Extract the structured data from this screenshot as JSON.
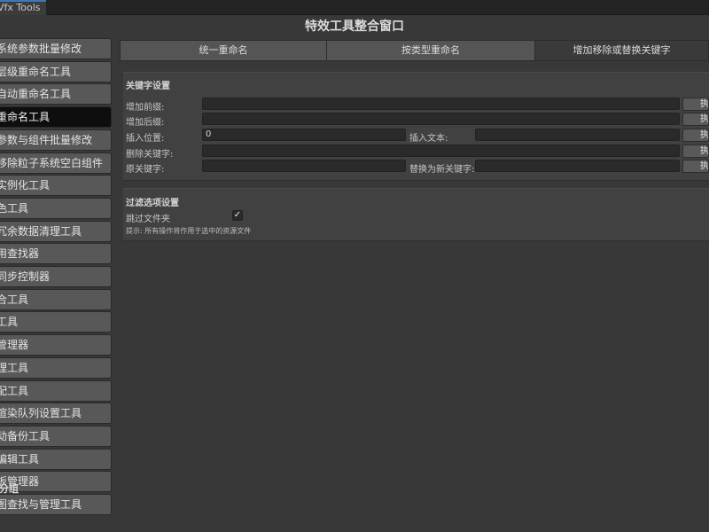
{
  "window": {
    "tab_label": "Vfx Tools",
    "title": "特效工具整合窗口"
  },
  "sidebar": {
    "items": [
      {
        "label": "系统参数批量修改"
      },
      {
        "label": "层级重命名工具"
      },
      {
        "label": "自动重命名工具"
      },
      {
        "label": "重命名工具",
        "active": true
      },
      {
        "label": "参数与组件批量修改"
      },
      {
        "label": "移除粒子系统空白组件"
      },
      {
        "label": "实例化工具"
      },
      {
        "label": "色工具"
      },
      {
        "label": "冗余数据清理工具"
      },
      {
        "label": "用查找器"
      },
      {
        "label": "同步控制器"
      },
      {
        "label": "合工具"
      },
      {
        "label": "工具"
      },
      {
        "label": "管理器"
      },
      {
        "label": "理工具"
      },
      {
        "label": "配工具"
      },
      {
        "label": "渲染队列设置工具"
      },
      {
        "label": "动备份工具"
      },
      {
        "label": "编辑工具"
      },
      {
        "label": "板管理器"
      },
      {
        "label": "图查找与管理工具"
      }
    ],
    "group_label": "分组"
  },
  "tabs": [
    {
      "label": "统一重命名"
    },
    {
      "label": "按类型重命名"
    },
    {
      "label": "增加移除或替换关键字",
      "active": true
    }
  ],
  "keyword": {
    "section_title": "关键字设置",
    "add_prefix_label": "增加前缀:",
    "add_prefix_value": "",
    "add_suffix_label": "增加后缀:",
    "add_suffix_value": "",
    "insert_pos_label": "插入位置:",
    "insert_pos_value": "0",
    "insert_text_label": "插入文本:",
    "insert_text_value": "",
    "remove_kw_label": "删除关键字:",
    "remove_kw_value": "",
    "orig_kw_label": "原关键字:",
    "orig_kw_value": "",
    "new_kw_label": "替换为新关键字:",
    "new_kw_value": "",
    "exec_label": "执行"
  },
  "filter": {
    "section_title": "过滤选项设置",
    "skip_folder_label": "跳过文件夹",
    "skip_folder_checked": true,
    "check_glyph": "✓",
    "hint": "提示: 所有操作将作用于选中的资源文件"
  }
}
